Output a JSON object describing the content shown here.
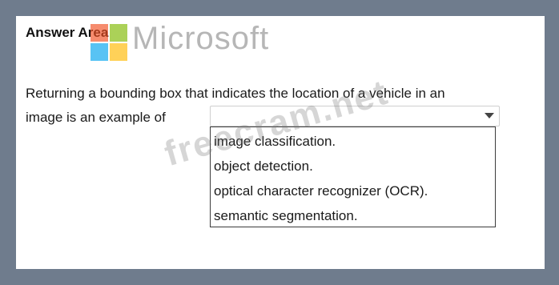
{
  "heading": "Answer Area",
  "question": {
    "line1": "Returning a bounding box that indicates the location of a vehicle in an",
    "line2": "image is an example of"
  },
  "dropdown": {
    "selected": "",
    "options": [
      "image classification.",
      "object detection.",
      "optical character recognizer (OCR).",
      "semantic segmentation."
    ]
  },
  "watermarks": {
    "brand": "Microsoft",
    "site": "freecram.net"
  },
  "colors": {
    "frame": "#6f7c8d",
    "panel": "#ffffff",
    "listbox_border": "#3c3c3c",
    "logo_red": "#f25022",
    "logo_green": "#7fba00",
    "logo_blue": "#00a4ef",
    "logo_yellow": "#ffb900"
  },
  "icons": {
    "dropdown_arrow": "chevron-down-icon",
    "logo": "microsoft-logo-icon"
  }
}
